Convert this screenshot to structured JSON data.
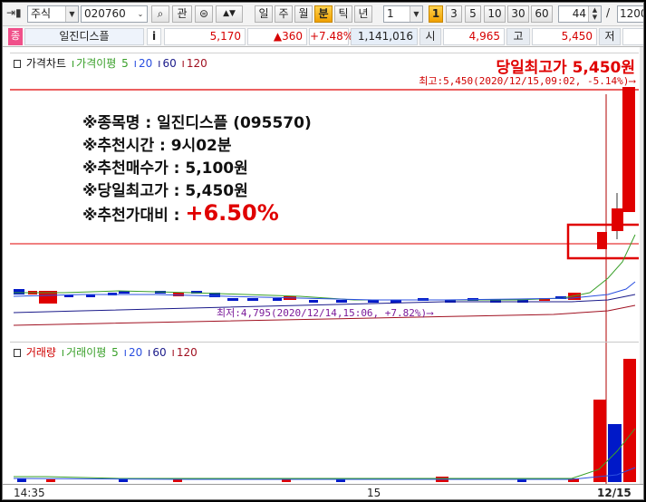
{
  "toolbar": {
    "market": "주식",
    "code": "020760",
    "fav_label": "관",
    "period_buttons": [
      "일",
      "주",
      "월",
      "분",
      "틱",
      "년"
    ],
    "active_period": "분",
    "interval_value": "1",
    "minute_shortcuts": [
      "1",
      "3",
      "5",
      "10",
      "30",
      "60"
    ],
    "active_minute": "1",
    "count_value": "44",
    "slash": "/",
    "total_value": "1200"
  },
  "quote": {
    "market_badge": "종",
    "name": "일진디스플",
    "info_label": "i",
    "price": "5,170",
    "change": "▲360",
    "change_rate": "+7.48%",
    "volume": "1,141,016",
    "open_label": "시",
    "open_value": "4,965",
    "high_label": "고",
    "high_value": "5,450",
    "low_label": "저"
  },
  "price_chart": {
    "legend": {
      "title": "가격차트",
      "ma_label": "가격이평",
      "ma_values": [
        "5",
        "20",
        "60",
        "120"
      ]
    },
    "headline": "당일최고가 5,450원",
    "high_marker": "최고:5,450(2020/12/15,09:02, -5.14%)⟶",
    "low_marker": "최저:4,795(2020/12/14,15:06, +7.82%)⟶"
  },
  "volume_chart": {
    "legend": {
      "title": "거래량",
      "ma_label": "거래이평",
      "ma_values": [
        "5",
        "20",
        "60",
        "120"
      ]
    }
  },
  "x_axis": {
    "labels": [
      "14:35",
      "15",
      "12/15"
    ]
  },
  "annotation": {
    "lines": [
      "※종목명 : 일진디스플 (095570)",
      "※추천시간 : 9시02분",
      "※추천매수가 : 5,100원",
      "※당일최고가 : 5,450원"
    ],
    "gain_label": "※추천가대비 : ",
    "gain_value": "+6.50%"
  },
  "colors": {
    "up": "#e00000",
    "down": "#0019c8",
    "ma5": "#3aa02a",
    "ma20": "#2a4fe0",
    "ma60": "#7a1a9a",
    "ma120": "#a01020",
    "accent": "#f0a000"
  },
  "chart_data": {
    "type": "candlestick",
    "note_high": 5450,
    "note_low": 4795,
    "recommended_buy": 5100,
    "high_time": "2020/12/15 09:02",
    "low_time": "2020/12/14 15:06"
  }
}
